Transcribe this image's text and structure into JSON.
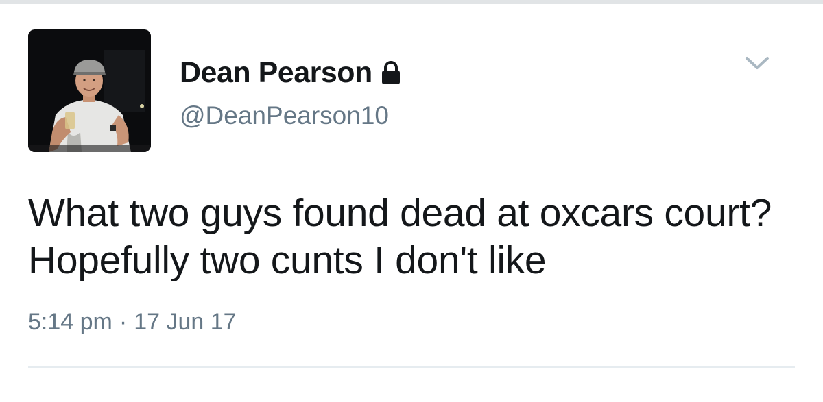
{
  "tweet": {
    "display_name": "Dean Pearson",
    "handle": "@DeanPearson10",
    "protected": true,
    "text": "What two guys found dead at oxcars court? Hopefully two cunts I don't like",
    "time": "5:14 pm",
    "separator": "·",
    "date": "17 Jun 17"
  },
  "icons": {
    "lock": "lock-icon",
    "caret": "chevron-down-icon",
    "avatar": "profile-photo"
  },
  "colors": {
    "primary_text": "#14171a",
    "secondary_text": "#657786",
    "divider": "#e6ecf0"
  }
}
